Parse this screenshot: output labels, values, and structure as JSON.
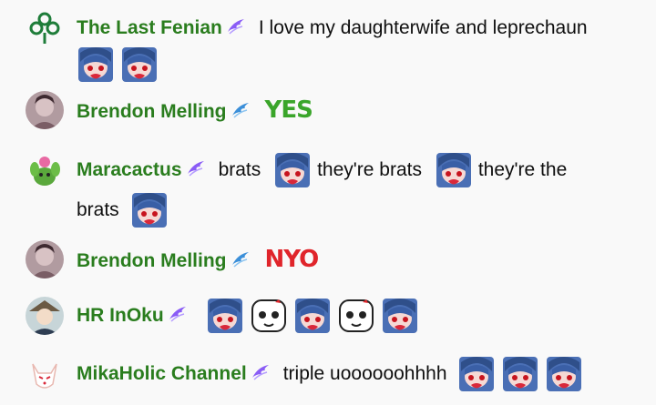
{
  "messages": [
    {
      "author": "The Last Fenian",
      "text": "I love my daughterwife and leprechaun",
      "emote_count": 2
    },
    {
      "author": "Brendon Melling",
      "text": "YES"
    },
    {
      "author": "Maracactus",
      "text_a": "brats",
      "text_b": "they're brats",
      "text_c": "they're the",
      "text_d": "brats"
    },
    {
      "author": "Brendon Melling",
      "text": "NYO"
    },
    {
      "author": "HR InOku",
      "emote_count": 5
    },
    {
      "author": "MikaHolic Channel",
      "text": "triple uoooooohhhh",
      "emote_count": 3
    }
  ],
  "colors": {
    "author": "#2a7d1e",
    "background": "#f9f9f9",
    "yes_emote": "#3aa52a",
    "nyo_emote": "#e0252b",
    "badge": "#8a5cf6"
  }
}
